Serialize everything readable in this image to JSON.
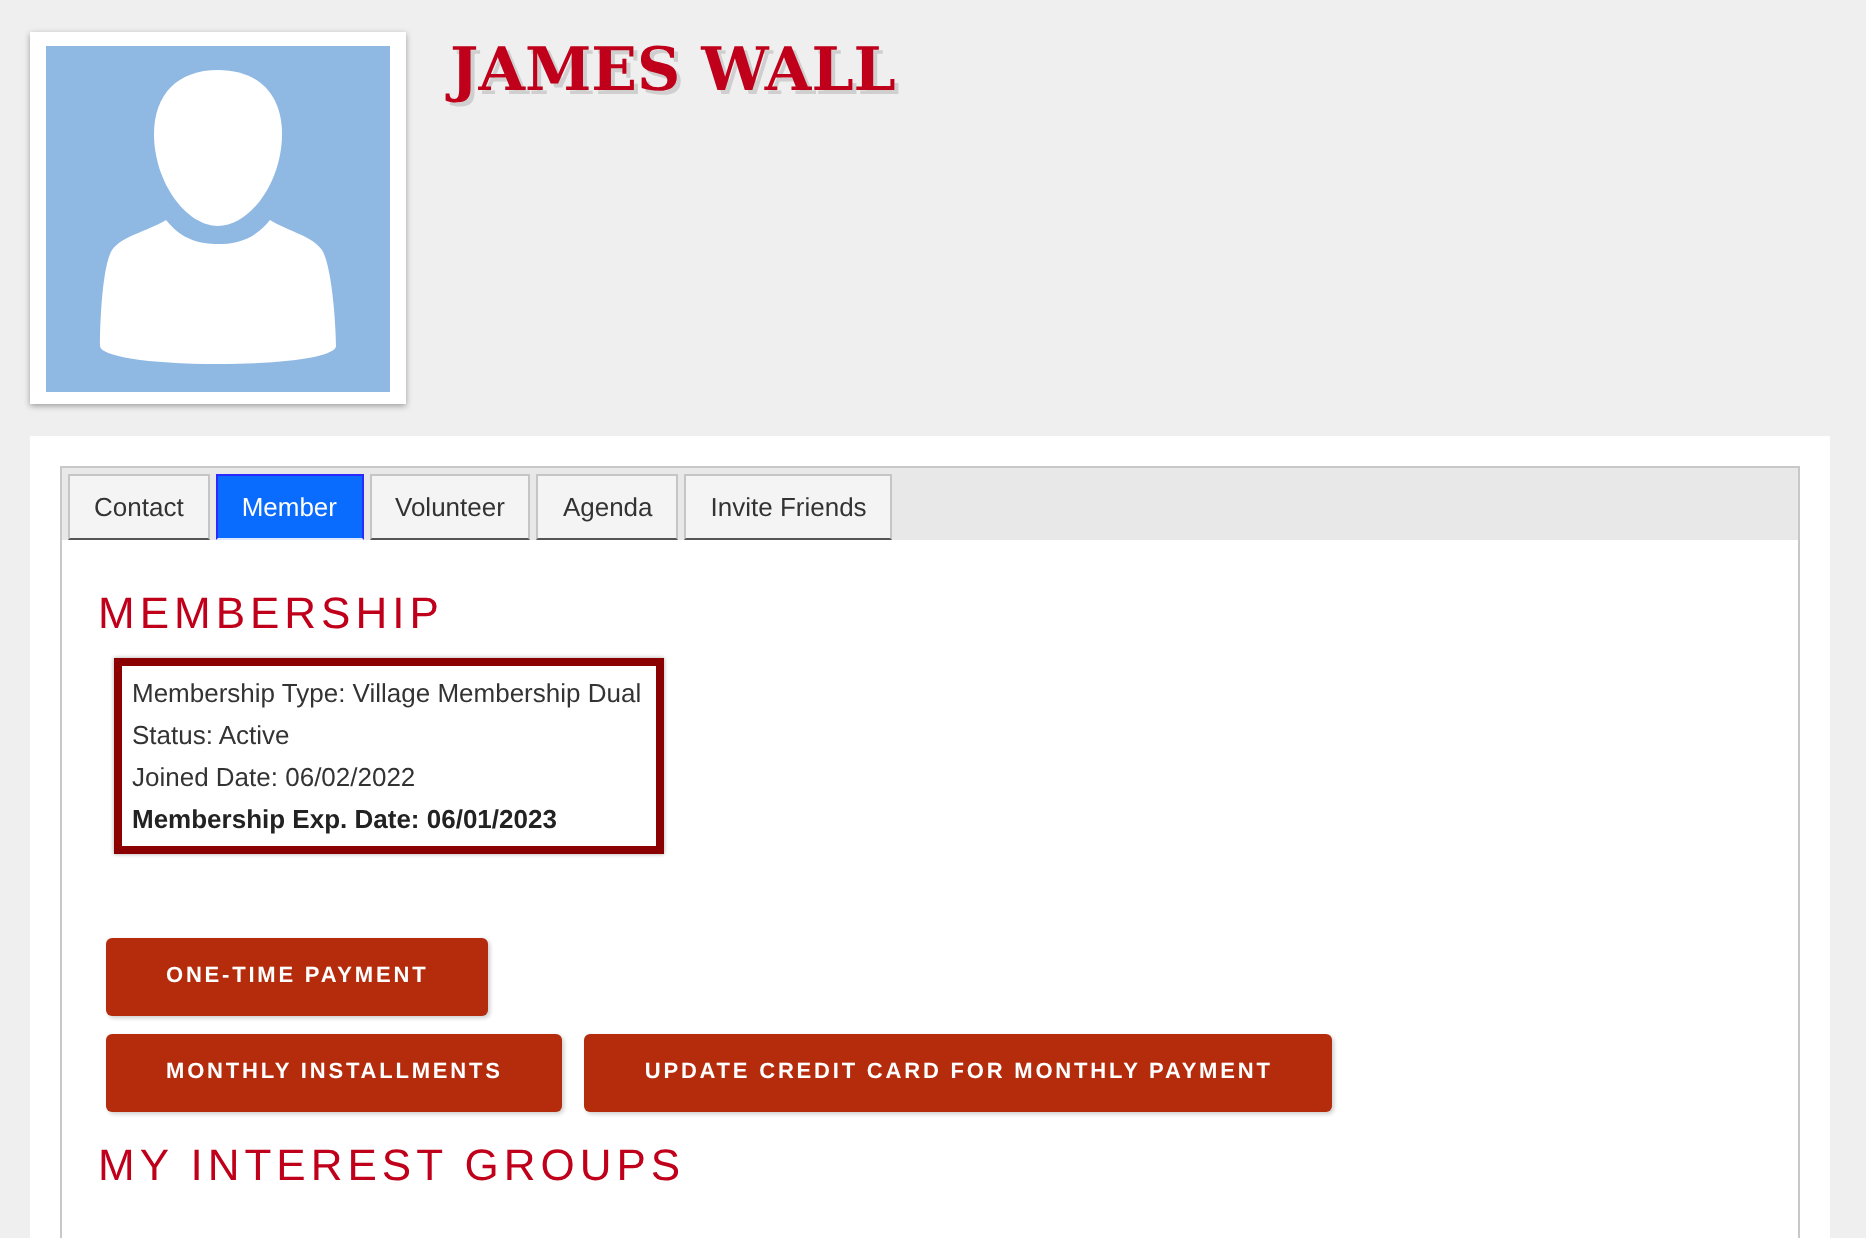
{
  "profile": {
    "name": "JAMES WALL"
  },
  "tabs": [
    {
      "label": "Contact",
      "selected": false
    },
    {
      "label": "Member",
      "selected": true
    },
    {
      "label": "Volunteer",
      "selected": false
    },
    {
      "label": "Agenda",
      "selected": false
    },
    {
      "label": "Invite Friends",
      "selected": false
    }
  ],
  "membership": {
    "heading": "MEMBERSHIP",
    "details": [
      {
        "text": "Membership Type: Village Membership Dual",
        "emphasized": false
      },
      {
        "text": "Status: Active",
        "emphasized": false
      },
      {
        "text": "Joined Date: 06/02/2022",
        "emphasized": false
      },
      {
        "text": "Membership Exp. Date: 06/01/2023",
        "emphasized": true
      }
    ]
  },
  "button_rows": [
    [
      "ONE-TIME PAYMENT"
    ],
    [
      "MONTHLY INSTALLMENTS",
      "UPDATE CREDIT CARD FOR MONTHLY PAYMENT"
    ]
  ],
  "interest_groups": {
    "heading": "MY INTEREST GROUPS"
  }
}
